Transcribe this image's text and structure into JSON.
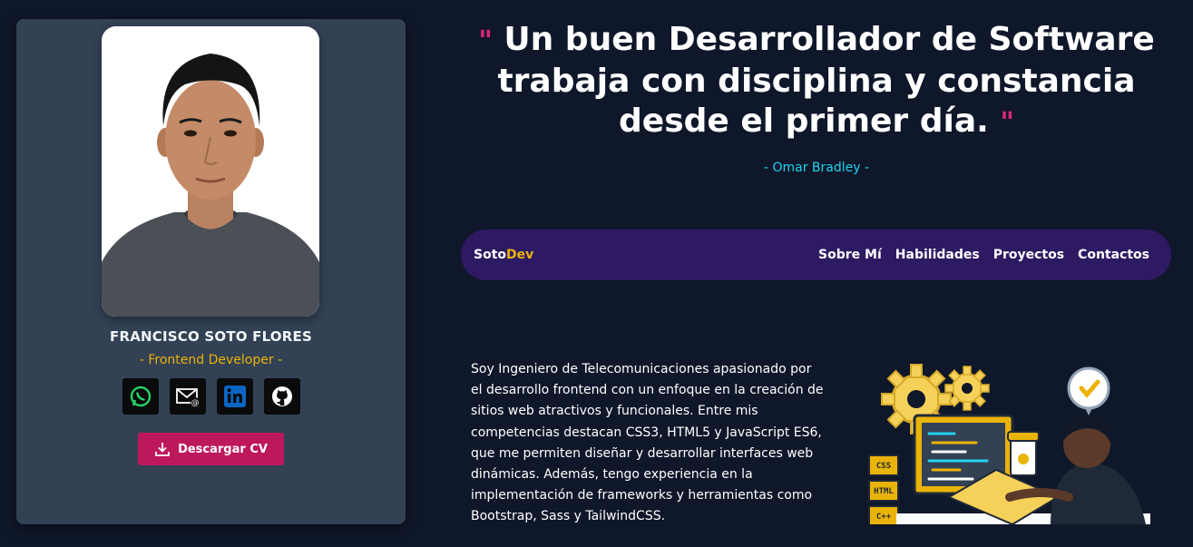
{
  "profile": {
    "name": "FRANCISCO SOTO FLORES",
    "role": "- Frontend Developer -",
    "socials": [
      "whatsapp-icon",
      "email-icon",
      "linkedin-icon",
      "github-icon"
    ],
    "cv_button_label": "Descargar CV"
  },
  "quote": {
    "open_mark": "\"",
    "text": "Un buen Desarrollador de Software trabaja con disciplina y constancia desde el primer día.",
    "close_mark": "\"",
    "author": "- Omar Bradley -"
  },
  "navbar": {
    "logo_part1": "Soto",
    "logo_part2": "Dev",
    "links": [
      "Sobre Mí",
      "Habilidades",
      "Proyectos",
      "Contactos"
    ]
  },
  "about": {
    "text": "Soy Ingeniero de Telecomunicaciones apasionado por el desarrollo frontend con un enfoque en la creación de sitios web atractivos y funcionales. Entre mis competencias destacan CSS3, HTML5 y JavaScript ES6, que me permiten diseñar y desarrollar interfaces web dinámicas. Además, tengo experiencia en la implementación de frameworks y herramientas como Bootstrap, Sass y TailwindCSS."
  },
  "illustration": {
    "badges": [
      "CSS",
      "HTML",
      "C++"
    ]
  },
  "colors": {
    "background": "#0f172a",
    "card": "#334155",
    "accent_pink": "#be185d",
    "accent_yellow": "#eab308",
    "accent_cyan": "#22d3ee",
    "navbar": "#2e1a63"
  }
}
